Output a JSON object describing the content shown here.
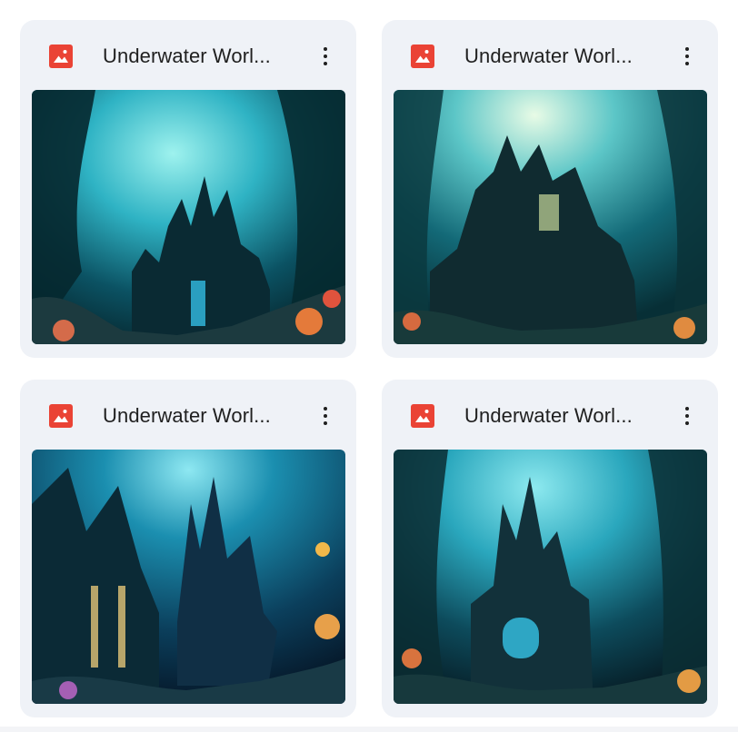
{
  "files": [
    {
      "title": "Underwater Worl...",
      "file_type_icon": "image-file-icon",
      "menu_icon": "more-vert-icon",
      "thumbnail": "underwater-castle-1"
    },
    {
      "title": "Underwater Worl...",
      "file_type_icon": "image-file-icon",
      "menu_icon": "more-vert-icon",
      "thumbnail": "underwater-castle-2"
    },
    {
      "title": "Underwater Worl...",
      "file_type_icon": "image-file-icon",
      "menu_icon": "more-vert-icon",
      "thumbnail": "underwater-castle-3"
    },
    {
      "title": "Underwater Worl...",
      "file_type_icon": "image-file-icon",
      "menu_icon": "more-vert-icon",
      "thumbnail": "underwater-castle-4"
    }
  ],
  "colors": {
    "card_background": "#eff2f7",
    "image_icon_red": "#ea4335",
    "text_primary": "#1f1f1f"
  }
}
